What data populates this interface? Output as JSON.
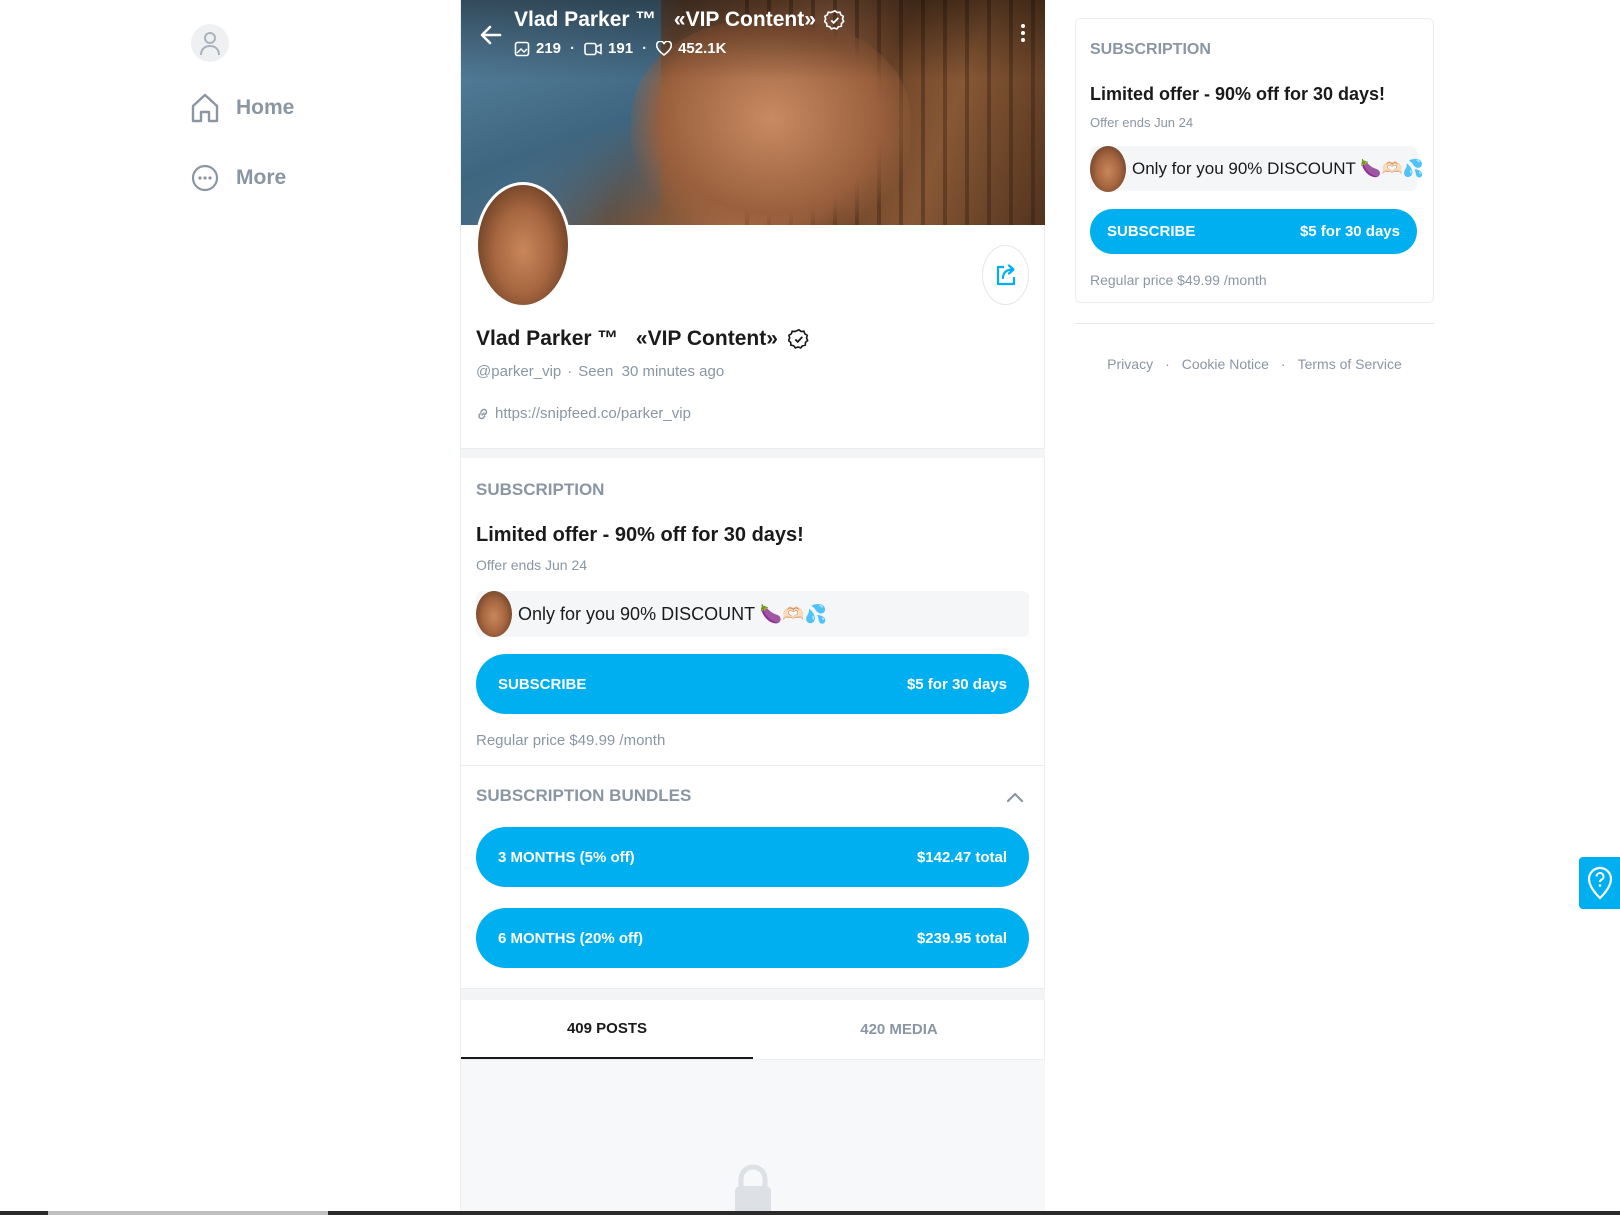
{
  "nav": {
    "items": [
      {
        "label": "Home",
        "icon": "home-icon"
      },
      {
        "label": "More",
        "icon": "more-circle-icon"
      }
    ]
  },
  "header": {
    "name": "Vlad Parker ™   «VIP Content»",
    "photos": "219",
    "videos": "191",
    "likes": "452.1K"
  },
  "profile": {
    "name": "Vlad Parker ™   «VIP Content»",
    "handle": "@parker_vip",
    "seen": "Seen  30 minutes ago",
    "link": "https://snipfeed.co/parker_vip"
  },
  "subscription": {
    "title": "SUBSCRIPTION",
    "offer": "Limited offer - 90% off for 30 days!",
    "ends": "Offer ends Jun 24",
    "message": "Only for you 90% DISCOUNT 🍆🫶🏻💦",
    "button_label": "SUBSCRIBE",
    "button_price": "$5 for 30 days",
    "regular_price": "Regular price $49.99 /month"
  },
  "bundles": {
    "title": "SUBSCRIPTION BUNDLES",
    "items": [
      {
        "label": "3 MONTHS (5% off)",
        "price": "$142.47 total"
      },
      {
        "label": "6 MONTHS (20% off)",
        "price": "$239.95 total"
      }
    ]
  },
  "tabs": [
    {
      "label": "409 POSTS",
      "active": true
    },
    {
      "label": "420 MEDIA",
      "active": false
    }
  ],
  "footer": {
    "links": [
      "Privacy",
      "Cookie Notice",
      "Terms of Service"
    ],
    "separator": "·"
  },
  "colors": {
    "accent": "#00aff0",
    "muted_text": "#8a96a3",
    "primary_text": "#1a1a1a"
  }
}
